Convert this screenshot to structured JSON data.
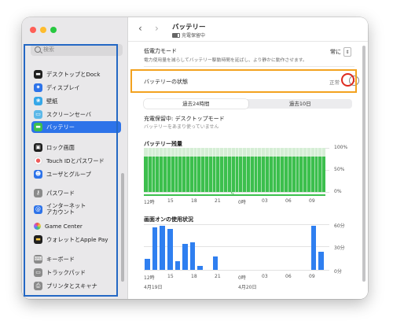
{
  "sidebar": {
    "search_placeholder": "検索",
    "items": [
      {
        "label": "デスクトップとDock",
        "icon": "dock-icon",
        "color": "#1f1f1f"
      },
      {
        "label": "ディスプレイ",
        "icon": "display-icon",
        "color": "#2d73e9"
      },
      {
        "label": "壁紙",
        "icon": "wallpaper-icon",
        "color": "#35a7e8"
      },
      {
        "label": "スクリーンセーバ",
        "icon": "screensaver-icon",
        "color": "#5cb8e8"
      },
      {
        "label": "バッテリー",
        "icon": "battery-icon",
        "color": "#3cbf4d"
      },
      {
        "label": "ロック画面",
        "icon": "lock-icon",
        "color": "#1f1f1f"
      },
      {
        "label": "Touch IDとパスワード",
        "icon": "fingerprint-icon",
        "color": "#ef5a5a"
      },
      {
        "label": "ユーザとグループ",
        "icon": "users-icon",
        "color": "#2d73e9"
      },
      {
        "label": "パスワード",
        "icon": "key-icon",
        "color": "#8a8a8a"
      },
      {
        "label": "インターネット\nアカウント",
        "icon": "at-icon",
        "color": "#2d73e9"
      },
      {
        "label": "Game Center",
        "icon": "game-center-icon",
        "color": "#ffffff"
      },
      {
        "label": "ウォレットとApple Pay",
        "icon": "wallet-icon",
        "color": "#1f1f1f"
      },
      {
        "label": "キーボード",
        "icon": "keyboard-icon",
        "color": "#8a8a8a"
      },
      {
        "label": "トラックパッド",
        "icon": "trackpad-icon",
        "color": "#8a8a8a"
      },
      {
        "label": "プリンタとスキャナ",
        "icon": "printer-icon",
        "color": "#8a8a8a"
      }
    ],
    "selected_index": 4
  },
  "header": {
    "title": "バッテリー",
    "subtitle": "充電保留中"
  },
  "low_power": {
    "title": "低電力モード",
    "description": "電力使用量を減らしてバッテリー駆動時間を延ばし、より静かに動作させます。",
    "value": "常に"
  },
  "health": {
    "label": "バッテリーの状態",
    "status": "正常",
    "info_icon": "info-icon"
  },
  "tabs": [
    {
      "label": "過去24時間",
      "active": true
    },
    {
      "label": "過去10日",
      "active": false
    }
  ],
  "charging": {
    "title": "充電保留中: デスクトップモード",
    "subtitle": "バッテリーをあまり使っていません"
  },
  "battery_chart": {
    "title": "バッテリー残量",
    "y_ticks": [
      "100%",
      "50%",
      "0%"
    ],
    "x_ticks": [
      "12時",
      "15",
      "18",
      "21",
      "0時",
      "03",
      "06",
      "09"
    ]
  },
  "usage_chart": {
    "title": "画面オンの使用状況",
    "y_ticks": [
      "60分",
      "30分",
      "0分"
    ],
    "x_ticks": [
      "12時",
      "15",
      "18",
      "21",
      "0時",
      "03",
      "06",
      "09"
    ],
    "dates": [
      "4月19日",
      "4月20日"
    ]
  },
  "chart_data": [
    {
      "type": "area",
      "title": "バッテリー残量",
      "x": [
        "12時",
        "15",
        "18",
        "21",
        "0時",
        "03",
        "06",
        "09"
      ],
      "series": [
        {
          "values": [
            80,
            80,
            80,
            80,
            80,
            80,
            80,
            80
          ]
        }
      ],
      "ylim": [
        0,
        100
      ]
    },
    {
      "type": "bar",
      "title": "画面オンの使用状況",
      "categories": [
        "12時",
        "",
        "",
        "15",
        "",
        "",
        "18",
        "",
        "",
        "21",
        "",
        "",
        "0時",
        "",
        "",
        "03",
        "",
        "",
        "06",
        "",
        "",
        "09",
        "",
        ""
      ],
      "values": [
        15,
        58,
        60,
        56,
        12,
        35,
        37,
        5,
        0,
        18,
        0,
        0,
        0,
        0,
        0,
        0,
        0,
        0,
        0,
        0,
        0,
        0,
        60,
        25
      ],
      "ylim": [
        0,
        60
      ]
    }
  ]
}
